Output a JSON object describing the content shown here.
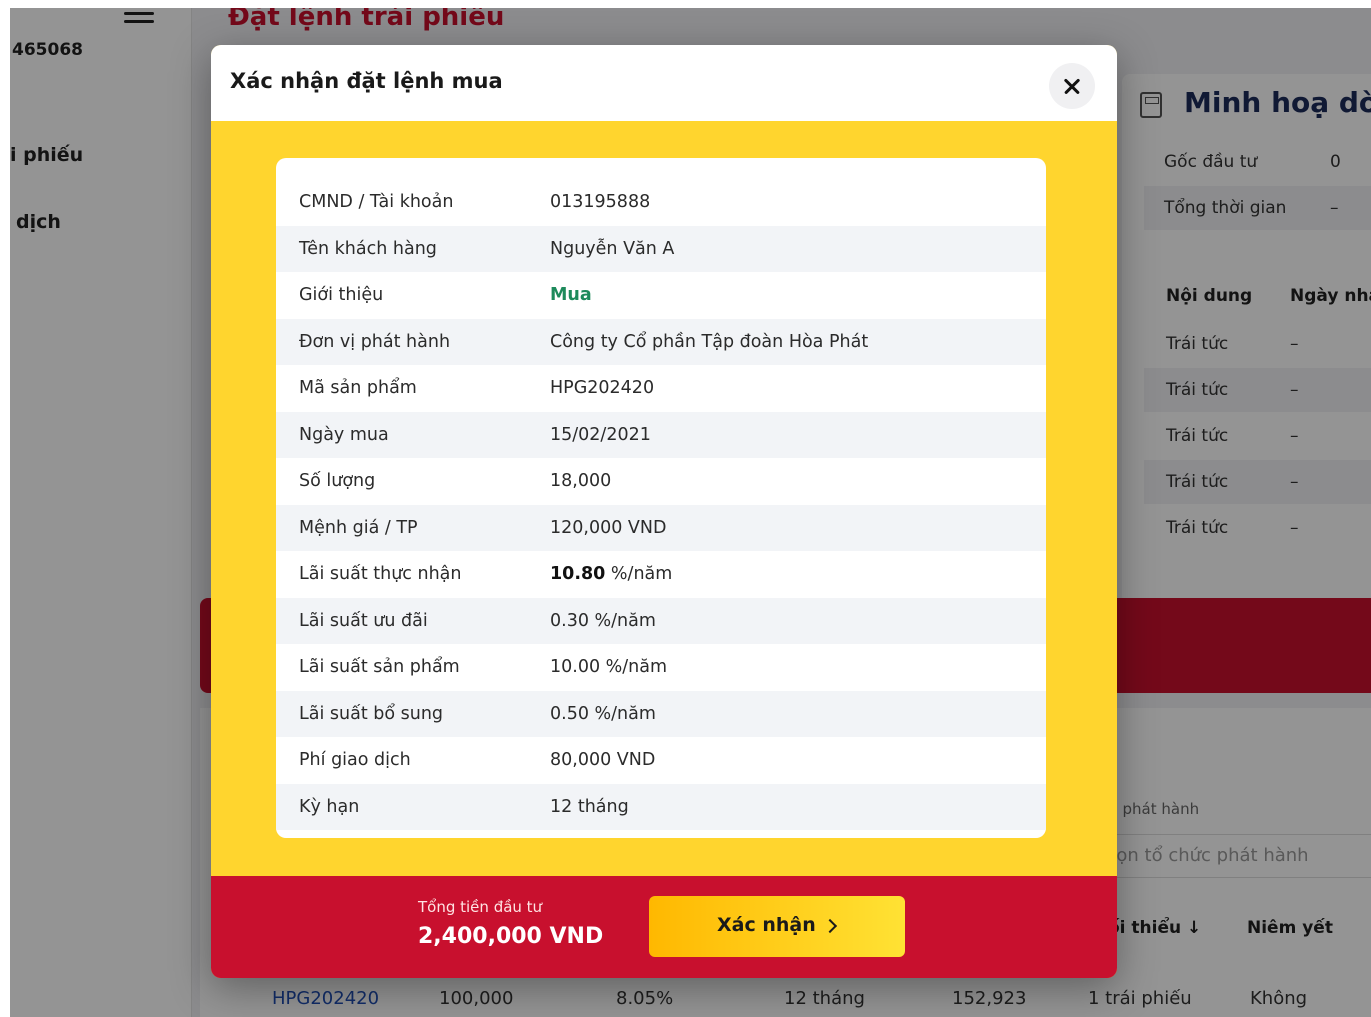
{
  "background": {
    "account_number": "465068",
    "sidebar_items": [
      "i phiếu",
      "dịch"
    ],
    "page_title": "Đặt lệnh trái phiếu",
    "right_panel": {
      "title": "Minh hoạ dòn",
      "rows": [
        {
          "label": "Gốc đầu tư",
          "value": "0"
        },
        {
          "label": "Tổng thời gian",
          "value": "–"
        }
      ],
      "table_headers": [
        "Nội dung",
        "Ngày nhậ"
      ],
      "table_rows": [
        {
          "c1": "Trái tức",
          "c2": "–"
        },
        {
          "c1": "Trái tức",
          "c2": "–"
        },
        {
          "c1": "Trái tức",
          "c2": "–"
        },
        {
          "c1": "Trái tức",
          "c2": "–"
        },
        {
          "c1": "Trái tức",
          "c2": "–"
        }
      ]
    },
    "filter": {
      "label": "ức phát hành",
      "placeholder": "họn tổ chức phát hành",
      "headers": [
        "ối thiểu ↓",
        "Niêm yết"
      ]
    },
    "product_row": [
      "HPG202420",
      "100,000",
      "8.05%",
      "12 tháng",
      "152,923",
      "1 trái phiếu",
      "Không"
    ]
  },
  "modal": {
    "title": "Xác nhận đặt lệnh mua",
    "details": [
      {
        "label": "CMND / Tài khoản",
        "value": "013195888"
      },
      {
        "label": "Tên khách hàng",
        "value": "Nguyễn Văn A"
      },
      {
        "label": "Giới thiệu",
        "value": "Mua"
      },
      {
        "label": "Đơn vị phát hành",
        "value": "Công ty Cổ phần Tập đoàn Hòa Phát"
      },
      {
        "label": "Mã sản phẩm",
        "value": "HPG202420"
      },
      {
        "label": "Ngày mua",
        "value": "15/02/2021"
      },
      {
        "label": "Số lượng",
        "value": "18,000"
      },
      {
        "label": "Mệnh giá / TP",
        "value": "120,000 VND"
      },
      {
        "label": "Lãi suất thực nhận",
        "value_bold": "10.80",
        "value_suffix": " %/năm"
      },
      {
        "label": "Lãi suất ưu đãi",
        "value": "0.30 %/năm"
      },
      {
        "label": "Lãi suất sản phẩm",
        "value": "10.00 %/năm"
      },
      {
        "label": "Lãi suất bổ sung",
        "value": "0.50 %/năm"
      },
      {
        "label": "Phí giao dịch",
        "value": "80,000 VND"
      },
      {
        "label": "Kỳ hạn",
        "value": "12 tháng"
      }
    ],
    "footer": {
      "total_label": "Tổng tiền đầu tư",
      "total_value": "2,400,000 VND",
      "confirm_label": "Xác nhận"
    }
  },
  "colors": {
    "brand_red": "#c8102e",
    "brand_yellow": "#ffd52e",
    "accent_green": "#1d8a5b",
    "link_blue": "#1f4fb5"
  }
}
